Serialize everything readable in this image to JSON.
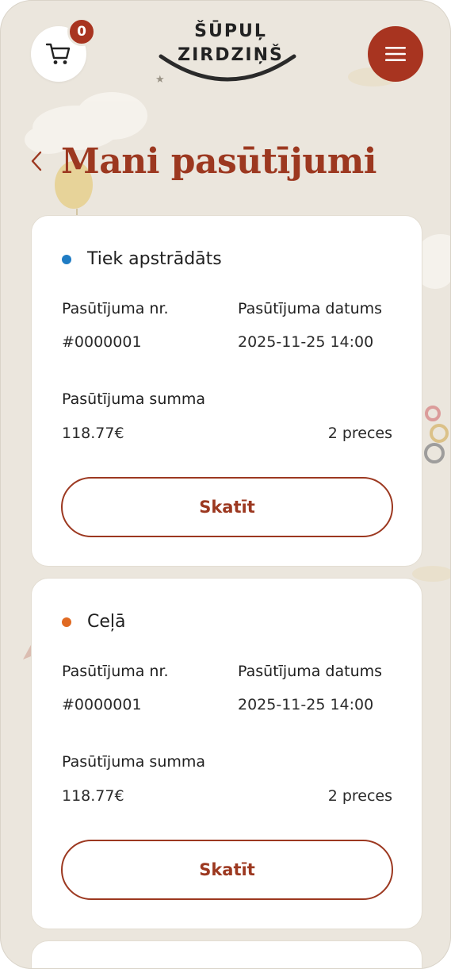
{
  "header": {
    "cart_count": "0",
    "logo_line1": "ŠŪPUĻ",
    "logo_line2": "ZIRDZIŅŠ"
  },
  "page_title": "Mani pasūtījumi",
  "labels": {
    "order_nr": "Pasūtījuma nr.",
    "order_date": "Pasūtījuma datums",
    "order_sum": "Pasūtījuma summa",
    "view_button": "Skatīt"
  },
  "orders": [
    {
      "status": "Tiek apstrādāts",
      "status_color": "#1f7cc4",
      "number": "#0000001",
      "date": "2025-11-25 14:00",
      "sum": "118.77€",
      "items": "2 preces"
    },
    {
      "status": "Ceļā",
      "status_color": "#e06a22",
      "number": "#0000001",
      "date": "2025-11-25 14:00",
      "sum": "118.77€",
      "items": "2 preces"
    }
  ],
  "colors": {
    "accent": "#a83420",
    "background": "#ebe6dd",
    "title": "#9c3820"
  },
  "icons": {
    "cart": "cart-icon",
    "menu": "hamburger-menu-icon",
    "back": "chevron-left-icon"
  }
}
